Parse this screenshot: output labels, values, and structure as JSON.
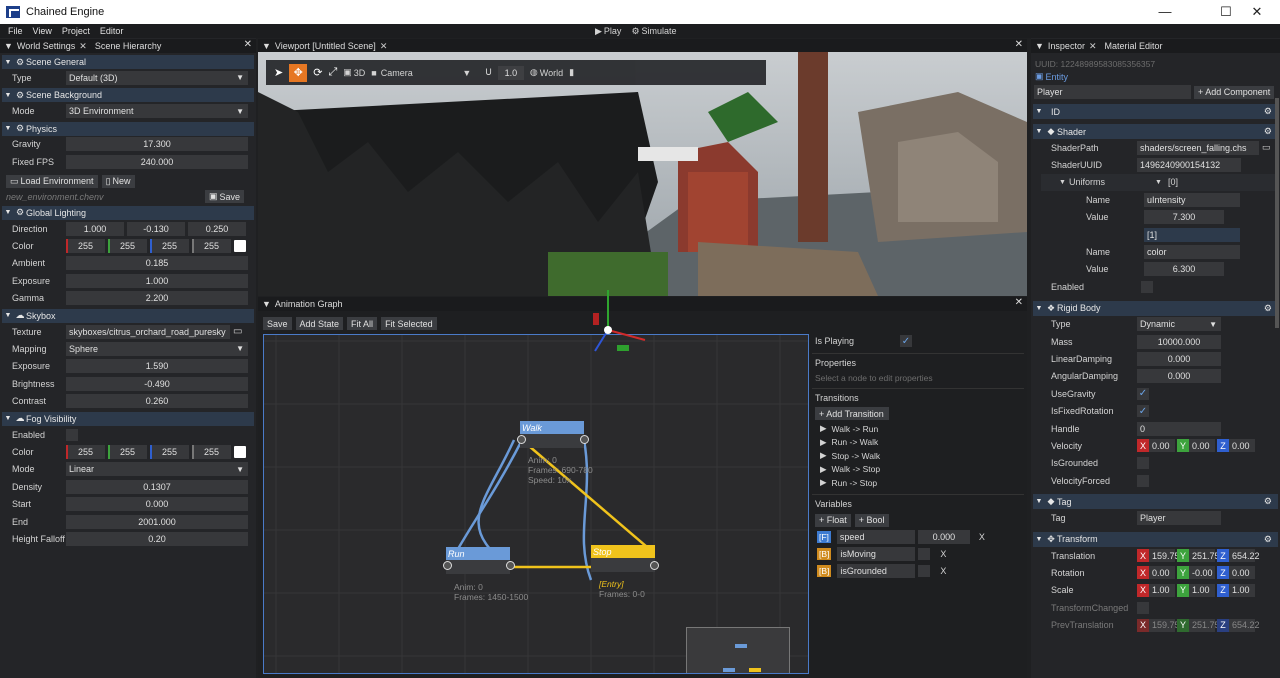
{
  "app": {
    "title": "Chained Engine"
  },
  "menu": [
    "File",
    "View",
    "Project",
    "Editor"
  ],
  "toolbar_top": {
    "play": "Play",
    "simulate": "Simulate"
  },
  "left_tabs": [
    "World Settings",
    "Scene Hierarchy"
  ],
  "world": {
    "scene_general": "Scene General",
    "type_label": "Type",
    "type_value": "Default (3D)",
    "scene_background": "Scene Background",
    "mode_label": "Mode",
    "mode_value": "3D Environment",
    "physics": "Physics",
    "gravity_label": "Gravity",
    "gravity_value": "17.300",
    "fps_label": "Fixed FPS",
    "fps_value": "240.000",
    "load_env": "Load Environment",
    "new": "New",
    "env_file": "new_environment.chenv",
    "save": "Save",
    "global_lighting": "Global Lighting",
    "direction_label": "Direction",
    "direction": [
      "1.000",
      "-0.130",
      "0.250"
    ],
    "color_label": "Color",
    "color": [
      "255",
      "255",
      "255",
      "255"
    ],
    "ambient_label": "Ambient",
    "ambient": "0.185",
    "exposure_label": "Exposure",
    "exposure": "1.000",
    "gamma_label": "Gamma",
    "gamma": "2.200",
    "skybox": "Skybox",
    "texture_label": "Texture",
    "texture": "skyboxes/citrus_orchard_road_puresky",
    "mapping_label": "Mapping",
    "mapping": "Sphere",
    "sky_exposure_label": "Exposure",
    "sky_exposure": "1.590",
    "brightness_label": "Brightness",
    "brightness": "-0.490",
    "contrast_label": "Contrast",
    "contrast": "0.260",
    "fog": "Fog Visibility",
    "enabled_label": "Enabled",
    "fog_color_label": "Color",
    "fog_color": [
      "255",
      "255",
      "255",
      "255"
    ],
    "fog_mode_label": "Mode",
    "fog_mode": "Linear",
    "density_label": "Density",
    "density": "0.1307",
    "start_label": "Start",
    "start": "0.000",
    "end_label": "End",
    "end": "2001.000",
    "height_label": "Height Falloff",
    "height": "0.20"
  },
  "viewport": {
    "tab": "Viewport [Untitled Scene]",
    "mode3d": "3D",
    "camera": "Camera",
    "snap": "1.0",
    "space": "World"
  },
  "anim": {
    "tab": "Animation Graph",
    "buttons": [
      "Save",
      "Add State",
      "Fit All",
      "Fit Selected"
    ],
    "nodes": {
      "walk": "Walk",
      "walk_info": [
        "Anim: 0",
        "Frames: 690-780",
        "Speed: 10x"
      ],
      "run": "Run",
      "run_info": [
        "Anim: 0",
        "Frames: 1450-1500"
      ],
      "stop": "Stop",
      "stop_entry": "[Entry]",
      "stop_info": [
        "Frames: 0-0"
      ]
    },
    "is_playing": "Is Playing",
    "properties": "Properties",
    "props_hint": "Select a node to edit properties",
    "transitions": "Transitions",
    "add_transition": "+ Add Transition",
    "transition_list": [
      "Walk -> Run",
      "Run -> Walk",
      "Stop -> Walk",
      "Walk -> Stop",
      "Run -> Stop"
    ],
    "variables": "Variables",
    "add_float": "+ Float",
    "add_bool": "+ Bool",
    "vars": [
      {
        "tag": "[F]",
        "name": "speed",
        "value": "0.000",
        "color": "#3d7bd1"
      },
      {
        "tag": "[B]",
        "name": "isMoving",
        "value": "",
        "color": "#d08b1e"
      },
      {
        "tag": "[B]",
        "name": "isGrounded",
        "value": "",
        "color": "#d08b1e"
      }
    ],
    "remove": "X"
  },
  "insp": {
    "tabs": [
      "Inspector",
      "Material Editor"
    ],
    "uuid": "UUID: 12248989583085356357",
    "entity": "Entity",
    "name": "Player",
    "add_component": "+ Add Component",
    "id": "ID",
    "shader": "Shader",
    "shader_path_label": "ShaderPath",
    "shader_path": "shaders/screen_falling.chs",
    "shader_uuid_label": "ShaderUUID",
    "shader_uuid": "1496240900154132",
    "uniforms": "Uniforms",
    "u0": "[0]",
    "name_label": "Name",
    "u0_name": "uIntensity",
    "value_label": "Value",
    "u0_value": "7.300",
    "u1": "[1]",
    "u1_name": "color",
    "u1_value": "6.300",
    "enabled_label": "Enabled",
    "rigid": "Rigid Body",
    "type_label": "Type",
    "type_value": "Dynamic",
    "mass_label": "Mass",
    "mass": "10000.000",
    "lin_label": "LinearDamping",
    "lin": "0.000",
    "ang_label": "AngularDamping",
    "ang": "0.000",
    "grav_label": "UseGravity",
    "fixrot_label": "IsFixedRotation",
    "handle_label": "Handle",
    "handle": "0",
    "vel_label": "Velocity",
    "vel": [
      "0.00",
      "0.00",
      "0.00"
    ],
    "ground_label": "IsGrounded",
    "vforced_label": "VelocityForced",
    "tag": "Tag",
    "tag_label": "Tag",
    "tag_value": "Player",
    "transform": "Transform",
    "trans_label": "Translation",
    "trans": [
      "159.75",
      "251.75",
      "654.22"
    ],
    "rot_label": "Rotation",
    "rot": [
      "0.00",
      "-0.00",
      "0.00"
    ],
    "scale_label": "Scale",
    "scale": [
      "1.00",
      "1.00",
      "1.00"
    ],
    "tchanged_label": "TransformChanged",
    "prev_label": "PrevTranslation",
    "prev": [
      "159.75",
      "251.75",
      "654.22"
    ]
  },
  "colors": {
    "accent": "#2d3a4b",
    "x": "#c0282a",
    "y": "#3da33d",
    "z": "#2f5fcf",
    "walk": "#6a9ad8",
    "stop": "#f0c31c",
    "run": "#6a9ad8"
  }
}
